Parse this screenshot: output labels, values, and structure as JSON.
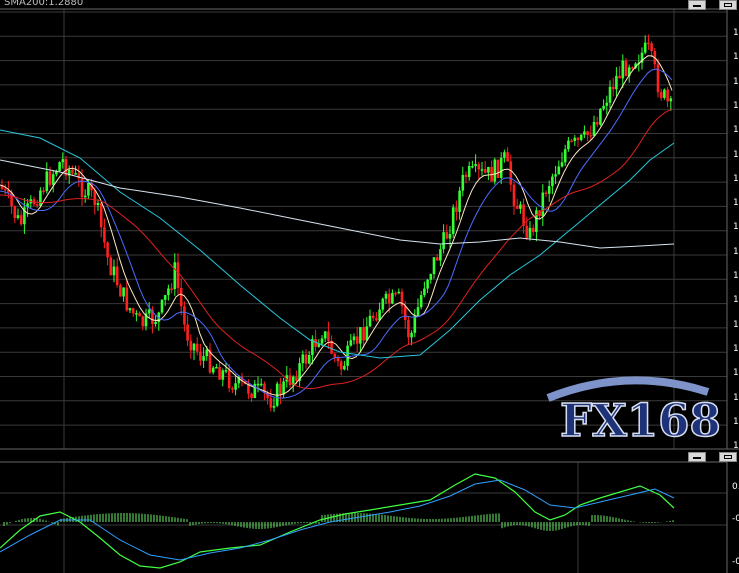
{
  "window": {
    "title": "SMA200:1.2880",
    "watermark": "FX168"
  },
  "main_axis_labels": [
    "1.",
    "1.",
    "1.",
    "1.",
    "1.",
    "1.",
    "1.",
    "1.",
    "1.",
    "1.",
    "1.",
    "1.",
    "1.",
    "1.",
    "1.",
    "1.",
    "1.",
    "1."
  ],
  "indicator_axis_labels": [
    "0.",
    "-0",
    "-0"
  ],
  "colors": {
    "background": "#000000",
    "grid": "#3a3a3a",
    "bull_candle": "#33ff33",
    "bear_candle": "#ff2020",
    "ma_fast_white": "#ffe9c0",
    "ma_blue": "#4a6cff",
    "ma_red": "#e02020",
    "ma_cyan": "#28c8dc",
    "sma200": "#d8e4f0",
    "macd_line": "#40ff40",
    "signal_line": "#30a0ff",
    "histogram": "#58c858"
  },
  "chart_data": {
    "type": "candlestick",
    "series": [
      {
        "name": "SMA200",
        "value": 1.288
      }
    ]
  }
}
